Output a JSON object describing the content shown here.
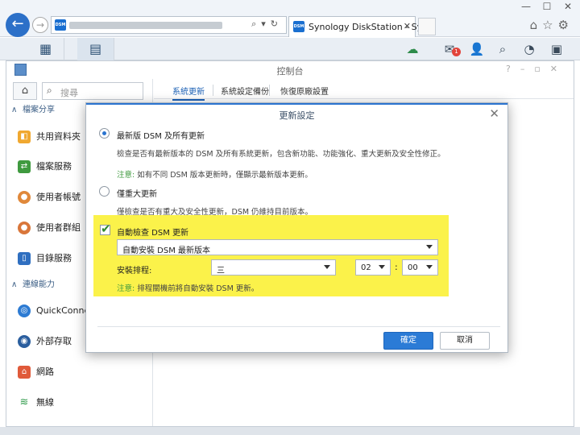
{
  "browser": {
    "tab_title": "Synology DiskStation - Sy...",
    "favicon_text": "DSM"
  },
  "window": {
    "title": "控制台"
  },
  "sidebar": {
    "search_placeholder": "搜尋",
    "sections": [
      {
        "label": "檔案分享",
        "items": [
          "共用資料夾",
          "檔案服務",
          "使用者帳號",
          "使用者群組",
          "目錄服務"
        ]
      },
      {
        "label": "連線能力",
        "items": [
          "QuickConnect",
          "外部存取",
          "網路",
          "無線"
        ]
      }
    ]
  },
  "main": {
    "tabs": [
      "系統更新",
      "系統設定備份",
      "恢復原廠設置"
    ]
  },
  "dialog": {
    "title": "更新設定",
    "option1_label": "最新版 DSM 及所有更新",
    "option1_desc": "檢查是否有最新版本的 DSM 及所有系統更新，包含新功能、功能強化、重大更新及安全性修正。",
    "option1_note_prefix": "注意:",
    "option1_note": " 如有不同 DSM 版本更新時，僅顯示最新版本更新。",
    "option2_label": "僅重大更新",
    "option2_desc": "僅檢查是否有重大及安全性更新，DSM 仍維持目前版本。",
    "auto_check_label": "自動檢查 DSM 更新",
    "auto_action_value": "自動安裝 DSM 最新版本",
    "schedule_label": "安裝排程:",
    "schedule_day": "三",
    "schedule_hour": "02",
    "schedule_minute": "00",
    "schedule_colon": ":",
    "schedule_note_prefix": "注意:",
    "schedule_note": " 排程關機前將自動安裝 DSM 更新。",
    "ok_label": "確定",
    "cancel_label": "取消"
  },
  "colors": {
    "accent": "#2b74cf",
    "highlight": "#fbf24a",
    "note_green": "#3f9a3f"
  }
}
